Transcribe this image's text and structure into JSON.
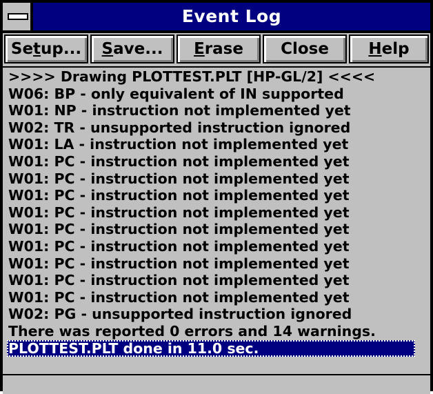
{
  "window": {
    "title": "Event Log"
  },
  "toolbar": {
    "buttons": [
      {
        "pre": "Se",
        "accel": "t",
        "post": "up..."
      },
      {
        "pre": "",
        "accel": "S",
        "post": "ave..."
      },
      {
        "pre": "",
        "accel": "E",
        "post": "rase"
      },
      {
        "pre": "Close",
        "accel": "",
        "post": ""
      },
      {
        "pre": "",
        "accel": "H",
        "post": "elp"
      }
    ]
  },
  "log": {
    "lines": [
      ">>>> Drawing PLOTTEST.PLT [HP-GL/2] <<<<",
      "W06: BP - only equivalent of IN supported",
      "W01: NP - instruction not implemented yet",
      "W02: TR - unsupported instruction ignored",
      "W01: LA - instruction not implemented yet",
      "W01: PC - instruction not implemented yet",
      "W01: PC - instruction not implemented yet",
      "W01: PC - instruction not implemented yet",
      "W01: PC - instruction not implemented yet",
      "W01: PC - instruction not implemented yet",
      "W01: PC - instruction not implemented yet",
      "W01: PC - instruction not implemented yet",
      "W01: PC - instruction not implemented yet",
      "W01: PC - instruction not implemented yet",
      "W02: PG - unsupported instruction ignored",
      "There was reported 0 errors and 14 warnings."
    ],
    "selected_line": "PLOTTEST.PLT done in 11.0 sec."
  },
  "colors": {
    "titlebar": "#000080",
    "face": "#c0c0c0",
    "selection": "#000080"
  }
}
